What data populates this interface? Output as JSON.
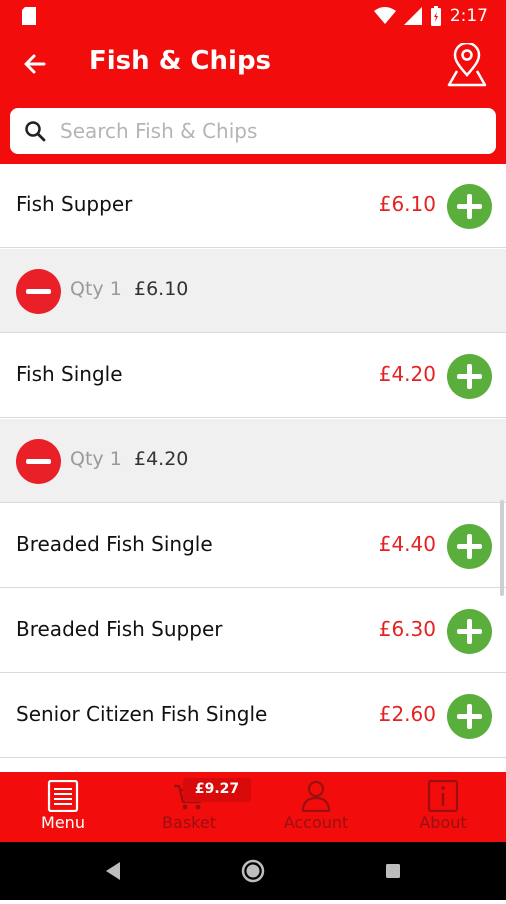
{
  "status_bar": {
    "time": "2:17"
  },
  "app_bar": {
    "title": "Fish & Chips"
  },
  "search": {
    "placeholder": "Search Fish & Chips",
    "value": ""
  },
  "items": [
    {
      "name": "Fish Supper",
      "price": "£6.10",
      "qty_label": "Qty 1",
      "qty_price": "£6.10"
    },
    {
      "name": "Fish Single",
      "price": "£4.20",
      "qty_label": "Qty 1",
      "qty_price": "£4.20"
    },
    {
      "name": "Breaded Fish Single",
      "price": "£4.40"
    },
    {
      "name": "Breaded Fish Supper",
      "price": "£6.30"
    },
    {
      "name": "Senior Citizen Fish Single",
      "price": "£2.60"
    }
  ],
  "bottom_nav": {
    "menu": "Menu",
    "basket": "Basket",
    "basket_total": "£9.27",
    "account": "Account",
    "about": "About"
  },
  "colors": {
    "brand_red": "#f20c0c",
    "add_green": "#5aaf3c",
    "remove_red": "#e92028",
    "price_red": "#e52222"
  },
  "icons": [
    "back-arrow-icon",
    "map-pin-icon",
    "search-icon",
    "plus-icon",
    "minus-icon",
    "menu-list-icon",
    "basket-icon",
    "account-icon",
    "info-icon"
  ]
}
